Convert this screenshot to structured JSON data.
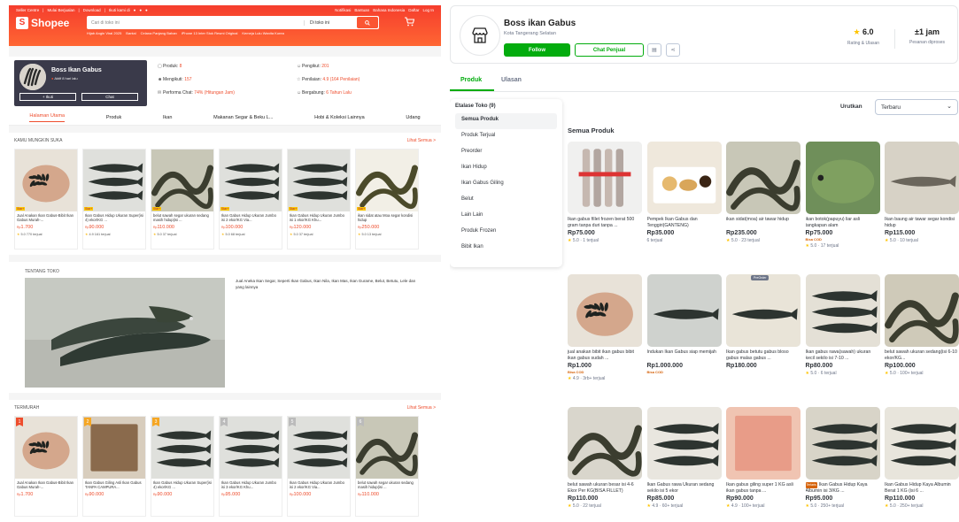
{
  "shopee": {
    "topbar_left": [
      "Seller Centre",
      "Mulai Berjualan",
      "Download",
      "Ikuti kami di"
    ],
    "topbar_right": [
      "Notifikasi",
      "Bantuan",
      "Bahasa Indonesia",
      "Daftar",
      "Log In"
    ],
    "logo_text": "Shopee",
    "search_placeholder": "Cari di toko ini",
    "search_scope": "Di toko ini",
    "search_hints": [
      "Hijab Angin Viral 2025",
      "Bantal",
      "Celana Panjang Bahan",
      "iPhone 13 Inter Stok Resmi Original",
      "Kemeja Lulu Wanita Korea"
    ],
    "shop": {
      "name": "Boss Ikan Gabus",
      "status": "Aktif 8 hari lalu",
      "follow_label": "+ Ikuti",
      "chat_label": "Chat",
      "stats": [
        {
          "label": "Produk:",
          "value": "8"
        },
        {
          "label": "Pengikut:",
          "value": "201"
        },
        {
          "label": "Mengikuti:",
          "value": "157"
        },
        {
          "label": "Penilaian:",
          "value": "4.9 (164 Penilaian)"
        },
        {
          "label": "Performa Chat:",
          "value": "74% (Hitungan Jam)"
        },
        {
          "label": "Bergabung:",
          "value": "6 Tahun Lalu"
        }
      ]
    },
    "tabs": [
      "Halaman Utama",
      "Produk",
      "Ikan",
      "Makanan Segar & Beku L...",
      "Hobi & Koleksi Lainnya",
      "Udang"
    ],
    "recommend": {
      "title": "KAMU MUNGKIN SUKA",
      "more": "Lihat Semua >",
      "items": [
        {
          "name": "Jual Anakan Ikan Gabus-Bibit Ikan Gabus Murah-...",
          "price": "1.700",
          "rating": "5.0",
          "sold": "770 terjual"
        },
        {
          "name": "Ikan Gabus Hidup Ukuran Super(isi 4) ekor/KG ...",
          "price": "90.000",
          "rating": "4.9",
          "sold": "161 terjual"
        },
        {
          "name": "belut sawah segar ukuran sedang masih hidup(isi ...",
          "price": "110.000",
          "rating": "5.0",
          "sold": "37 terjual"
        },
        {
          "name": "Ikan Gabus Hidup Ukuran Jumbo isi 2 ekor/KG Via...",
          "price": "100.000",
          "rating": "5.0",
          "sold": "68 terjual"
        },
        {
          "name": "Ikan Gabus Hidup Ukuran Jumbo isi 1 ekor/KG Khu...",
          "price": "120.000",
          "rating": "5.0",
          "sold": "37 terjual"
        },
        {
          "name": "ikan sidat atau Moa segar kondisi hidup",
          "price": "250.000",
          "rating": "5.0",
          "sold": "13 terjual"
        }
      ]
    },
    "about": {
      "title": "TENTANG TOKO",
      "desc": "Jual Aneka Ikan Segar, Seperti Ikan Gabus, Ikan Nila, Ikan Mas, Ikan Gurame, Belut, Betutu, Lele dan yang lainnya"
    },
    "best": {
      "title": "TERMURAH",
      "more": "Lihat Semua >",
      "items": [
        {
          "rank": "1",
          "name": "Jual Anakan Ikan Gabus-Bibit Ikan Gabus Murah-...",
          "price": "1.700"
        },
        {
          "rank": "2",
          "name": "Ikan Gabus Giling Asli Ikan Gabus TANPA CAMPURA...",
          "price": "90.000"
        },
        {
          "rank": "3",
          "name": "Ikan Gabus Hidup Ukuran Super(isi 4) ekor/KG ...",
          "price": "90.000"
        },
        {
          "rank": "4",
          "name": "Ikan Gabus Hidup Ukuran Jumbo isi 3 ekor/KG Khu...",
          "price": "95.000"
        },
        {
          "rank": "5",
          "name": "Ikan Gabus Hidup Ukuran Jumbo isi 2 ekor/KG Via...",
          "price": "100.000"
        },
        {
          "rank": "6",
          "name": "belut sawah segar ukuran sedang masih hidup(isi ...",
          "price": "110.000"
        }
      ]
    },
    "currency": "Rp",
    "tag_label": "Star+"
  },
  "tokopedia": {
    "shop_name": "Boss ikan Gabus",
    "location": "Kota Tangerang Selatan",
    "follow_label": "Follow",
    "chat_label": "Chat Penjual",
    "rating_value": "6.0",
    "rating_label": "Rating & Ulasan",
    "process_value": "±1 jam",
    "process_label": "Pesanan diproses",
    "tabs": [
      "Produk",
      "Ulasan"
    ],
    "etalase_title": "Etalase Toko (9)",
    "etalase": [
      "Semua Produk",
      "Produk Terjual",
      "Preorder",
      "Ikan Hidup",
      "Ikan Gabus Giling",
      "Belut",
      "Lain Lain",
      "Produk Frozen",
      "Bibit Ikan"
    ],
    "sort_label": "Urutkan",
    "sort_value": "Terbaru",
    "section_title": "Semua Produk",
    "preorder_badge": "PreOrder",
    "products": [
      {
        "name": "Ikan gabus fillet frozen berat 500 gram tanpa duri tanpa ...",
        "price": "Rp75.000",
        "cod": "",
        "meta": "5.0 · 1 terjual",
        "img": "fillet"
      },
      {
        "name": "Pempek Ikan Gabus dan Tenggiri(GANTENG)",
        "price": "Rp35.000",
        "cod": "",
        "meta": "6 terjual",
        "img": "pempek"
      },
      {
        "name": "ikan sidat(moa) air tawar hidup",
        "price": "Rp235.000",
        "cod": "",
        "meta": "5.0 · 23 terjual",
        "img": "eel"
      },
      {
        "name": "ikan botok(papuyu) liar asli tangkapan alam",
        "price": "Rp75.000",
        "cod": "Bisa COD",
        "meta": "5.0 · 17 terjual",
        "img": "papuyu"
      },
      {
        "name": "Ikan baung air tawar segar kondisi hidup",
        "price": "Rp115.000",
        "cod": "",
        "meta": "5.0 · 10 terjual",
        "img": "baung"
      },
      {
        "name": "jual anakan bibit ikan gabus bibit ikan gabus sudah ...",
        "price": "Rp1.000",
        "cod": "Bisa COD",
        "meta": "4.9 · 3rb+ terjual",
        "img": "hand"
      },
      {
        "name": "Indukan Ikan Gabus siap memijah",
        "price": "Rp1.000.000",
        "cod": "Bisa COD",
        "meta": "",
        "img": "big"
      },
      {
        "name": "Ikan gabus betutu gabus bloso gabus malas gabus ...",
        "price": "Rp180.000",
        "cod": "",
        "meta": "",
        "img": "betutu",
        "preorder": true
      },
      {
        "name": "Ikan gabus rawa(sawah) ukuran kecil sekilo isi 7-10 ...",
        "price": "Rp80.000",
        "cod": "",
        "meta": "5.0 · 6 terjual",
        "img": "rawa"
      },
      {
        "name": "belut sawah ukuran sedang(isi 6-10 ekor/KG...",
        "price": "Rp100.000",
        "cod": "",
        "meta": "5.0 · 100+ terjual",
        "img": "belut"
      },
      {
        "name": "belut sawah ukuran besar isi 4-6 Ekor Per KG(BISA FILLET)",
        "price": "Rp110.000",
        "cod": "",
        "meta": "5.0 · 22 terjual",
        "img": "belutb"
      },
      {
        "name": "Ikan Gabus rawa Ukuran sedang sekilo isi 5 ekor",
        "price": "Rp85.000",
        "cod": "",
        "meta": "4.9 · 60+ terjual",
        "img": "sedang"
      },
      {
        "name": "Ikan gabus giling super 1 KG asli ikan gabus tanpa ...",
        "price": "Rp90.000",
        "cod": "",
        "meta": "4.9 · 100+ terjual",
        "img": "giling"
      },
      {
        "name": "Ikan Gabus Hidup Kaya Albumin isi 3/KG ...",
        "price": "Rp95.000",
        "cod": "",
        "meta": "5.0 · 250+ terjual",
        "img": "hidup3",
        "badge": "Terlaris"
      },
      {
        "name": "Ikan Gabus Hidup Kaya Albumin Berat 1 KG (isi 6 ...",
        "price": "Rp110.000",
        "cod": "",
        "meta": "5.0 · 250+ terjual",
        "img": "hidup6"
      }
    ]
  }
}
